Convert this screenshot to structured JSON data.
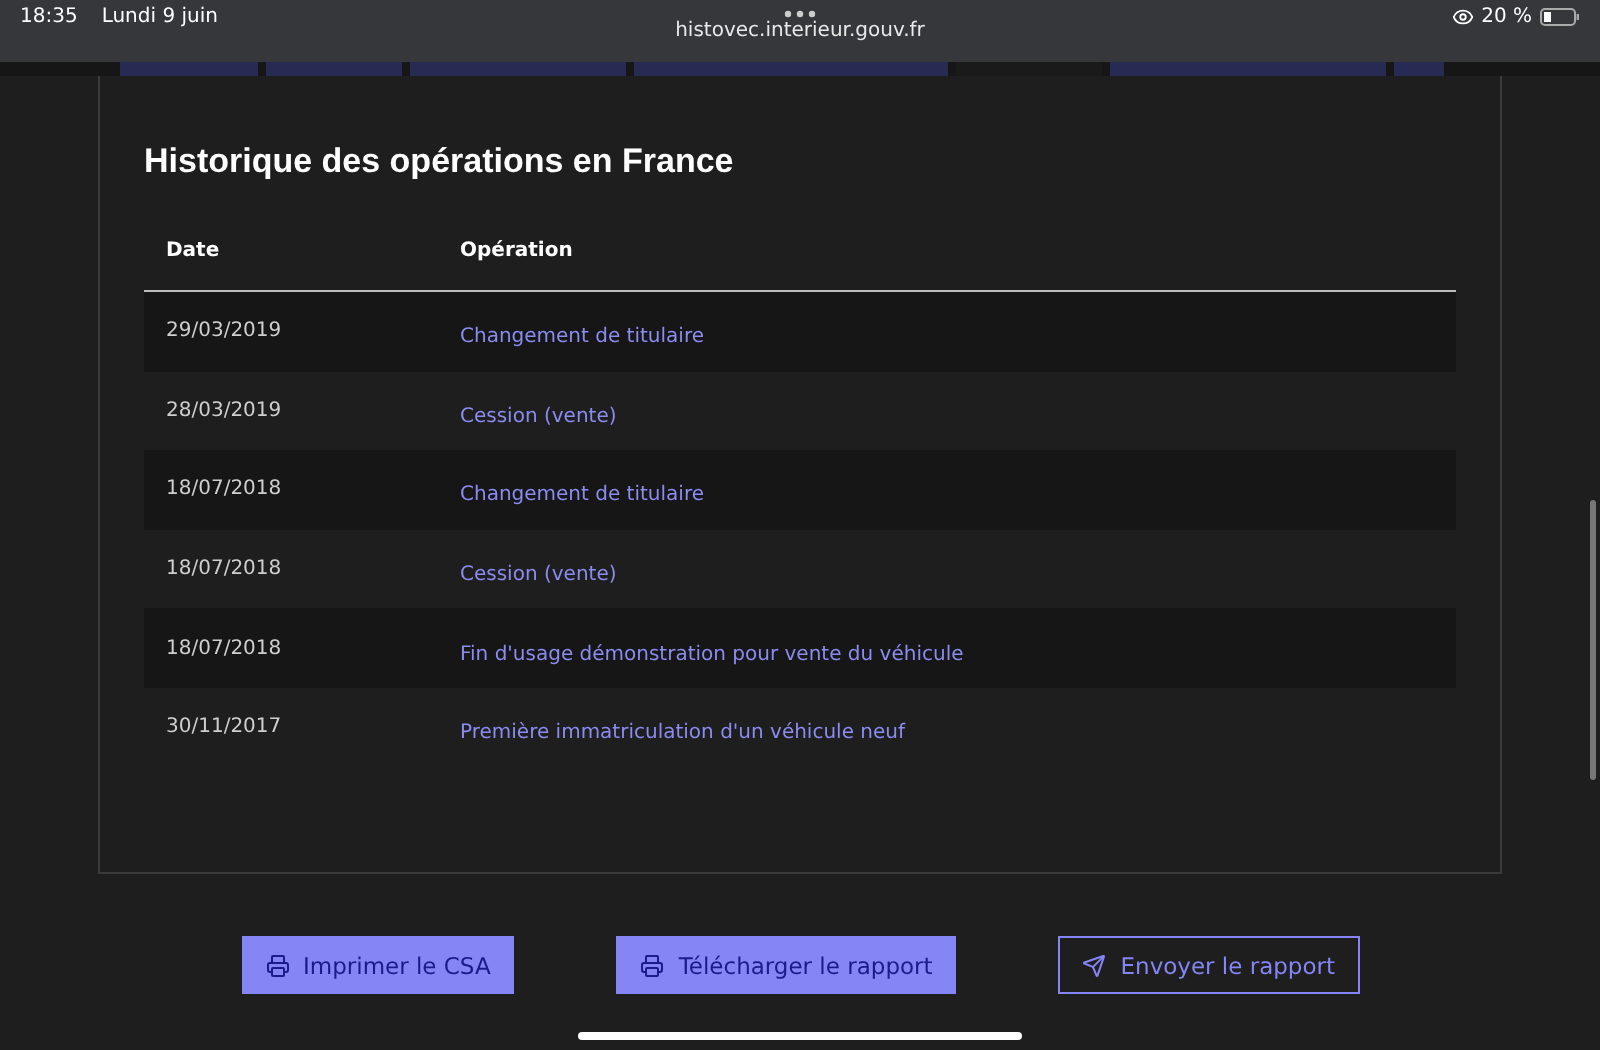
{
  "status_bar": {
    "time": "18:35",
    "date": "Lundi 9 juin",
    "url": "histovec.interieur.gouv.fr",
    "battery": "20 %"
  },
  "section": {
    "title": "Historique des opérations en France",
    "table": {
      "columns": [
        "Date",
        "Opération"
      ],
      "rows": [
        {
          "date": "29/03/2019",
          "operation": "Changement de titulaire"
        },
        {
          "date": "28/03/2019",
          "operation": "Cession (vente)"
        },
        {
          "date": "18/07/2018",
          "operation": "Changement de titulaire"
        },
        {
          "date": "18/07/2018",
          "operation": "Cession (vente)"
        },
        {
          "date": "18/07/2018",
          "operation": "Fin d'usage démonstration pour vente du véhicule"
        },
        {
          "date": "30/11/2017",
          "operation": "Première immatriculation d'un véhicule neuf"
        }
      ]
    }
  },
  "buttons": [
    {
      "label": "Imprimer le CSA",
      "kind": "print",
      "primary": true
    },
    {
      "label": "Télécharger le rapport",
      "kind": "print",
      "primary": true
    },
    {
      "label": "Envoyer le rapport",
      "kind": "send",
      "primary": false
    }
  ]
}
